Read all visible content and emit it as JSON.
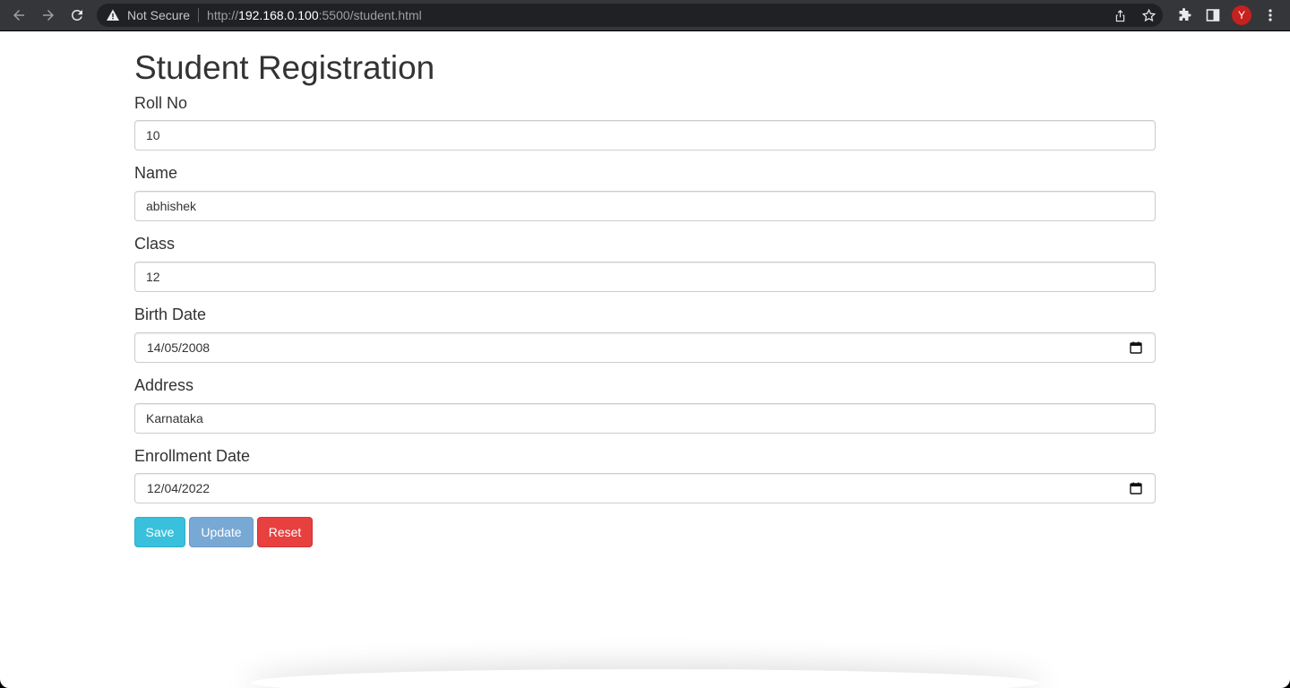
{
  "browser": {
    "security_text": "Not Secure",
    "url_scheme": "http://",
    "url_host": "192.168.0.100",
    "url_rest": ":5500/student.html",
    "avatar_letter": "Y"
  },
  "page": {
    "title": "Student Registration"
  },
  "form": {
    "fields": [
      {
        "label": "Roll No",
        "value": "10"
      },
      {
        "label": "Name",
        "value": "abhishek"
      },
      {
        "label": "Class",
        "value": "12"
      },
      {
        "label": "Birth Date",
        "value": "14/05/2008"
      },
      {
        "label": "Address",
        "value": "Karnataka"
      },
      {
        "label": "Enrollment Date",
        "value": "12/04/2022"
      }
    ],
    "buttons": {
      "save": "Save",
      "update": "Update",
      "reset": "Reset"
    }
  },
  "colors": {
    "save": "#39c0dc",
    "update": "#77a9d4",
    "reset": "#e7403f"
  }
}
